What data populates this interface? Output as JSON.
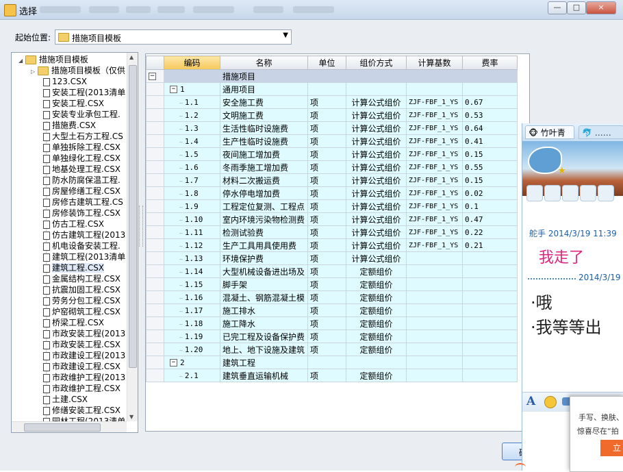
{
  "window": {
    "title": "选择",
    "buttons": [
      "—",
      "□",
      "×"
    ]
  },
  "start_location": {
    "label": "起始位置:",
    "value": "措施项目模板"
  },
  "tree": {
    "root": "措施项目模板",
    "folder": "措施项目模板（仅供",
    "files": [
      "123.CSX",
      "安装工程(2013清单",
      "安装工程.CSX",
      "安装专业承包工程.",
      "措施费.CSX",
      "大型土石方工程.CS",
      "单独拆除工程.CSX",
      "单独绿化工程.CSX",
      "地基处理工程.CSX",
      "防水防腐保温工程.",
      "房屋修缮工程.CSX",
      "房修古建筑工程.CS",
      "房修装饰工程.CSX",
      "仿古工程.CSX",
      "仿古建筑工程(2013",
      "机电设备安装工程.",
      "建筑工程(2013清单",
      "建筑工程.CSX",
      "金属结构工程.CSX",
      "抗震加固工程.CSX",
      "劳务分包工程.CSX",
      "炉窑砌筑工程.CSX",
      "桥梁工程.CSX",
      "市政安装工程(2013",
      "市政安装工程.CSX",
      "市政建设工程(2013",
      "市政建设工程.CSX",
      "市政维护工程(2013",
      "市政维护工程.CSX",
      "土建.CSX",
      "修缮安装工程.CSX",
      "园林工程(2013清单"
    ],
    "selected_index": 17
  },
  "grid": {
    "columns": [
      "编码",
      "名称",
      "单位",
      "组价方式",
      "计算基数",
      "费率"
    ],
    "rows": [
      {
        "code": "",
        "name": "措施项目",
        "unit": "",
        "method": "",
        "base": "",
        "rate": "",
        "type": "root",
        "toggle": "−"
      },
      {
        "code": "1",
        "name": "通用项目",
        "unit": "",
        "method": "",
        "base": "",
        "rate": "",
        "type": "group",
        "toggle": "−"
      },
      {
        "code": "1.1",
        "name": "安全施工费",
        "unit": "项",
        "method": "计算公式组价",
        "base": "ZJF-FBF_1_YS",
        "rate": "0.67",
        "type": "item"
      },
      {
        "code": "1.2",
        "name": "文明施工费",
        "unit": "项",
        "method": "计算公式组价",
        "base": "ZJF-FBF_1_YS",
        "rate": "0.53",
        "type": "item"
      },
      {
        "code": "1.3",
        "name": "生活性临时设施费",
        "unit": "项",
        "method": "计算公式组价",
        "base": "ZJF-FBF_1_YS",
        "rate": "0.64",
        "type": "item"
      },
      {
        "code": "1.4",
        "name": "生产性临时设施费",
        "unit": "项",
        "method": "计算公式组价",
        "base": "ZJF-FBF_1_YS",
        "rate": "0.41",
        "type": "item"
      },
      {
        "code": "1.5",
        "name": "夜间施工增加费",
        "unit": "项",
        "method": "计算公式组价",
        "base": "ZJF-FBF_1_YS",
        "rate": "0.15",
        "type": "item"
      },
      {
        "code": "1.6",
        "name": "冬雨季施工增加费",
        "unit": "项",
        "method": "计算公式组价",
        "base": "ZJF-FBF_1_YS",
        "rate": "0.55",
        "type": "item"
      },
      {
        "code": "1.7",
        "name": "材料二次搬运费",
        "unit": "项",
        "method": "计算公式组价",
        "base": "ZJF-FBF_1_YS",
        "rate": "0.15",
        "type": "item"
      },
      {
        "code": "1.8",
        "name": "停水停电增加费",
        "unit": "项",
        "method": "计算公式组价",
        "base": "ZJF-FBF_1_YS",
        "rate": "0.02",
        "type": "item"
      },
      {
        "code": "1.9",
        "name": "工程定位复测、工程点",
        "unit": "项",
        "method": "计算公式组价",
        "base": "ZJF-FBF_1_YS",
        "rate": "0.1",
        "type": "item"
      },
      {
        "code": "1.10",
        "name": "室内环境污染物检测费",
        "unit": "项",
        "method": "计算公式组价",
        "base": "ZJF-FBF_1_YS",
        "rate": "0.47",
        "type": "item"
      },
      {
        "code": "1.11",
        "name": "检测试验费",
        "unit": "项",
        "method": "计算公式组价",
        "base": "ZJF-FBF_1_YS",
        "rate": "0.22",
        "type": "item"
      },
      {
        "code": "1.12",
        "name": "生产工具用具使用费",
        "unit": "项",
        "method": "计算公式组价",
        "base": "ZJF-FBF_1_YS",
        "rate": "0.21",
        "type": "item"
      },
      {
        "code": "1.13",
        "name": "环境保护费",
        "unit": "项",
        "method": "计算公式组价",
        "base": "",
        "rate": "",
        "type": "item"
      },
      {
        "code": "1.14",
        "name": "大型机械设备进出场及",
        "unit": "项",
        "method": "定额组价",
        "base": "",
        "rate": "",
        "type": "item"
      },
      {
        "code": "1.15",
        "name": "脚手架",
        "unit": "项",
        "method": "定额组价",
        "base": "",
        "rate": "",
        "type": "item"
      },
      {
        "code": "1.16",
        "name": "混凝土、钢筋混凝土模",
        "unit": "项",
        "method": "定额组价",
        "base": "",
        "rate": "",
        "type": "item"
      },
      {
        "code": "1.17",
        "name": "施工排水",
        "unit": "项",
        "method": "定额组价",
        "base": "",
        "rate": "",
        "type": "item"
      },
      {
        "code": "1.18",
        "name": "施工降水",
        "unit": "项",
        "method": "定额组价",
        "base": "",
        "rate": "",
        "type": "item"
      },
      {
        "code": "1.19",
        "name": "已完工程及设备保护费",
        "unit": "项",
        "method": "定额组价",
        "base": "",
        "rate": "",
        "type": "item"
      },
      {
        "code": "1.20",
        "name": "地上、地下设施及建筑",
        "unit": "项",
        "method": "定额组价",
        "base": "",
        "rate": "",
        "type": "item"
      },
      {
        "code": "2",
        "name": "建筑工程",
        "unit": "",
        "method": "",
        "base": "",
        "rate": "",
        "type": "group",
        "toggle": "−"
      },
      {
        "code": "2.1",
        "name": "建筑垂直运输机械",
        "unit": "项",
        "method": "定额组价",
        "base": "",
        "rate": "",
        "type": "item"
      }
    ]
  },
  "ok_button": {
    "label": "确"
  },
  "chat": {
    "tab_label": "竹叶青",
    "sender_line": "舵手 2014/3/19 11:39",
    "message1": "我走了",
    "date2": "2014/3/19",
    "message2": "·哦",
    "message3": "·我等等出",
    "toolbar_font_icon": "A"
  },
  "popup": {
    "line1": "手写、换肤、",
    "line2": "惊喜尽在“拍",
    "button": "立即"
  },
  "colors": {
    "grid_row_bg": "#dffbff",
    "grid_selected_header": "#f6c85a",
    "chat_message_pink": "#e0247d",
    "chat_blue": "#1d5fa8",
    "popup_orange": "#f06a2b"
  }
}
